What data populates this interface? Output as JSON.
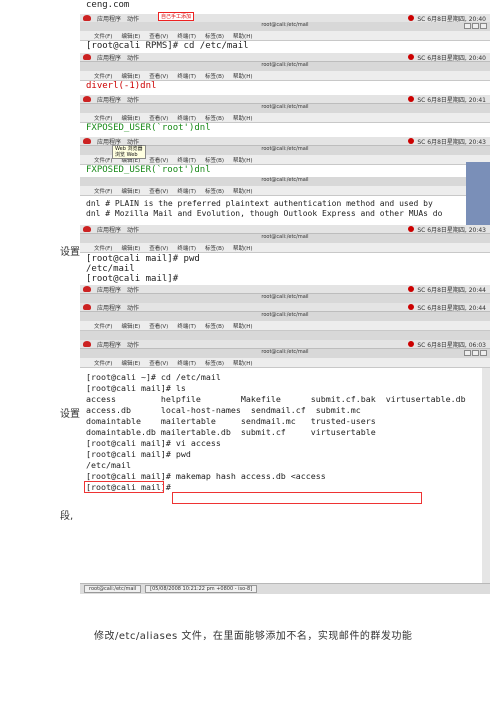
{
  "panel": {
    "apps": "应用程序",
    "actions": "动作",
    "clock_a": "SC 6月8日星期四, 20:40",
    "clock_b": "SC 6月8日星期四, 20:41",
    "clock_c": "SC 6月8日星期四, 20:43",
    "clock_d": "SC 6月8日星期四, 20:44",
    "clock_e": "SC 6月8日星期四, 06:03"
  },
  "window": {
    "title": "root@cali:/etc/mail",
    "menus": [
      "文件(F)",
      "编辑(E)",
      "查看(V)",
      "终端(T)",
      "标签(B)",
      "帮助(H)"
    ]
  },
  "strips": {
    "s0_text": "ceng.com",
    "s0_note": "自己手工添加",
    "s1_text": "[root@cali RPMS]# cd /etc/mail",
    "s2_text": "diverl(-1)dnl",
    "s3_text": "FXPOSED_USER(`root')dnl",
    "s4_text": "FXPOSED_USER(`root')dnl",
    "s4_popup_a": "Web 浏览器",
    "s4_popup_b": "浏览 Web",
    "s5_line1": "dnl # PLAIN is the preferred plaintext authentication method and used by",
    "s5_line2": "dnl # Mozilla Mail and Evolution, though Outlook Express and other MUAs do",
    "s6_line1": "[root@cali mail]# pwd",
    "s6_line2": "/etc/mail",
    "s6_line3": "[root@cali mail]# "
  },
  "captions": {
    "left1": "设置",
    "left2": "设置",
    "left3": "段,",
    "bottom": "修改/etc/aliases 文件，在里面能够添加不名，实现邮件的群发功能"
  },
  "terminal": {
    "lines": [
      "[root@cali ~]# cd /etc/mail",
      "[root@cali mail]# ls",
      "access         helpfile        Makefile      submit.cf.bak  virtusertable.db",
      "access.db      local-host-names  sendmail.cf  submit.mc",
      "domaintable    mailertable     sendmail.mc   trusted-users",
      "domaintable.db mailertable.db  submit.cf     virtusertable",
      "[root@cali mail]# vi access",
      "[root@cali mail]# pwd",
      "/etc/mail",
      "[root@cali mail]# makemap hash access.db <access",
      "[root@cali mail]#"
    ]
  },
  "taskbar": {
    "task1": "root@cali:/etc/mail",
    "task2": "[05/08/2008 10:21:22 pm +0800 - iso-8]"
  }
}
